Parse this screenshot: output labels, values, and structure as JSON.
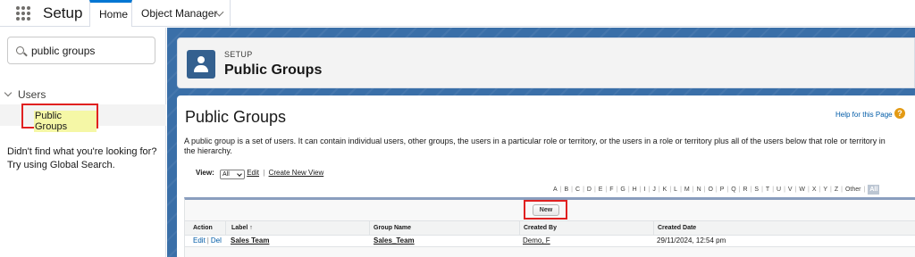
{
  "topbar": {
    "app_name": "Setup",
    "tabs": [
      {
        "label": "Home"
      },
      {
        "label": "Object Manager"
      }
    ]
  },
  "sidebar": {
    "search": {
      "value": "public groups"
    },
    "tree": {
      "group_label": "Users",
      "item_label": "Public Groups"
    },
    "not_found_line1": "Didn't find what you're looking for?",
    "not_found_line2": "Try using Global Search."
  },
  "header": {
    "eyebrow": "SETUP",
    "title": "Public Groups"
  },
  "content": {
    "title": "Public Groups",
    "help_link": "Help for this Page",
    "help_icon": "?",
    "description": "A public group is a set of users. It can contain individual users, other groups, the users in a particular role or territory, or the users in a role or territory plus all of the users below that role or territory in the hierarchy.",
    "view": {
      "label": "View:",
      "selected": "All",
      "edit_link": "Edit",
      "separator": "|",
      "create_link": "Create New View"
    },
    "alphabet": [
      "A",
      "B",
      "C",
      "D",
      "E",
      "F",
      "G",
      "H",
      "I",
      "J",
      "K",
      "L",
      "M",
      "N",
      "O",
      "P",
      "Q",
      "R",
      "S",
      "T",
      "U",
      "V",
      "W",
      "X",
      "Y",
      "Z",
      "Other",
      "All"
    ],
    "new_button": "New",
    "table": {
      "headers": {
        "action": "Action",
        "label": "Label ↑",
        "group_name": "Group Name",
        "created_by": "Created By",
        "created_date": "Created Date"
      },
      "rows": [
        {
          "edit": "Edit",
          "sep": "|",
          "del": "Del",
          "label": "Sales Team",
          "group_name": "Sales_Team",
          "created_by": "Demo, F",
          "created_date": "29/11/2024, 12:54 pm"
        }
      ]
    }
  },
  "colors": {
    "accent": "#0176d3",
    "link": "#015ba7",
    "highlight_box": "#e02020",
    "search_highlight": "#f5f7a6",
    "header_icon": "#34608f"
  },
  "icons": [
    "app-launcher-icon",
    "search-icon",
    "chevron-down-icon",
    "user-group-icon",
    "help-icon"
  ]
}
